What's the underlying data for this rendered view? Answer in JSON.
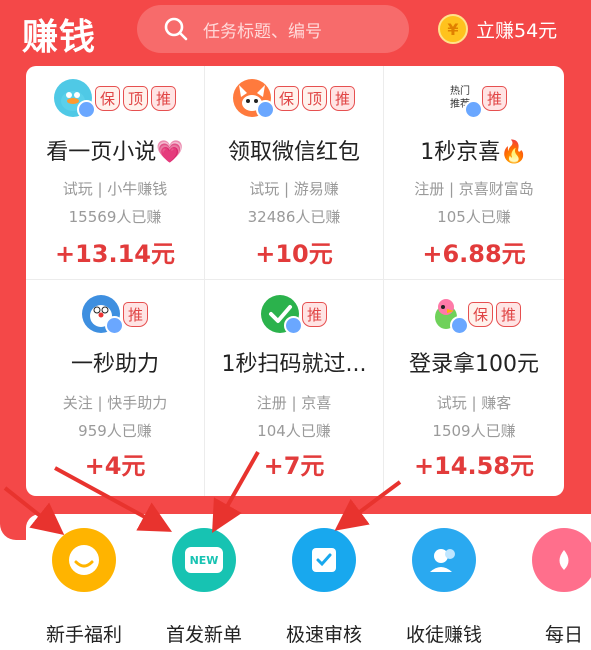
{
  "header": {
    "logo": "赚钱",
    "search_placeholder": "任务标题、编号",
    "earn_text": "立赚54元",
    "coin_symbol": "¥"
  },
  "tags": {
    "bao": "保",
    "ding": "顶",
    "tui": "推",
    "hot": "热门",
    "rec": "推荐"
  },
  "tasks": [
    {
      "title": "看一页小说💗",
      "sub": "试玩 | 小牛赚钱",
      "count": "15569人已赚",
      "price": "+13.14元"
    },
    {
      "title": "领取微信红包",
      "sub": "试玩 | 游易赚",
      "count": "32486人已赚",
      "price": "+10元"
    },
    {
      "title": "1秒京喜🔥",
      "sub": "注册 | 京喜财富岛",
      "count": "105人已赚",
      "price": "+6.88元"
    },
    {
      "title": "一秒助力",
      "sub": "关注 | 快手助力",
      "count": "959人已赚",
      "price": "+4元"
    },
    {
      "title": "1秒扫码就过...",
      "sub": "注册 | 京喜",
      "count": "104人已赚",
      "price": "+7元"
    },
    {
      "title": "登录拿100元",
      "sub": "试玩 | 赚客",
      "count": "1509人已赚",
      "price": "+14.58元"
    }
  ],
  "nav": [
    {
      "label": "新手福利",
      "icon": "smile-face-icon",
      "color": "#ffb400"
    },
    {
      "label": "首发新单",
      "icon": "new-badge-icon",
      "color": "#17c3b2",
      "badge": "NEW"
    },
    {
      "label": "极速审核",
      "icon": "checkbox-icon",
      "color": "#18a8ee"
    },
    {
      "label": "收徒赚钱",
      "icon": "users-icon",
      "color": "#2aa9f0"
    },
    {
      "label": "每日",
      "icon": "daily-icon",
      "color": "#ff6f8c"
    }
  ],
  "colors": {
    "brand_red": "#f44848",
    "price_red": "#e23b3b",
    "arrow_red": "#e8332e"
  }
}
